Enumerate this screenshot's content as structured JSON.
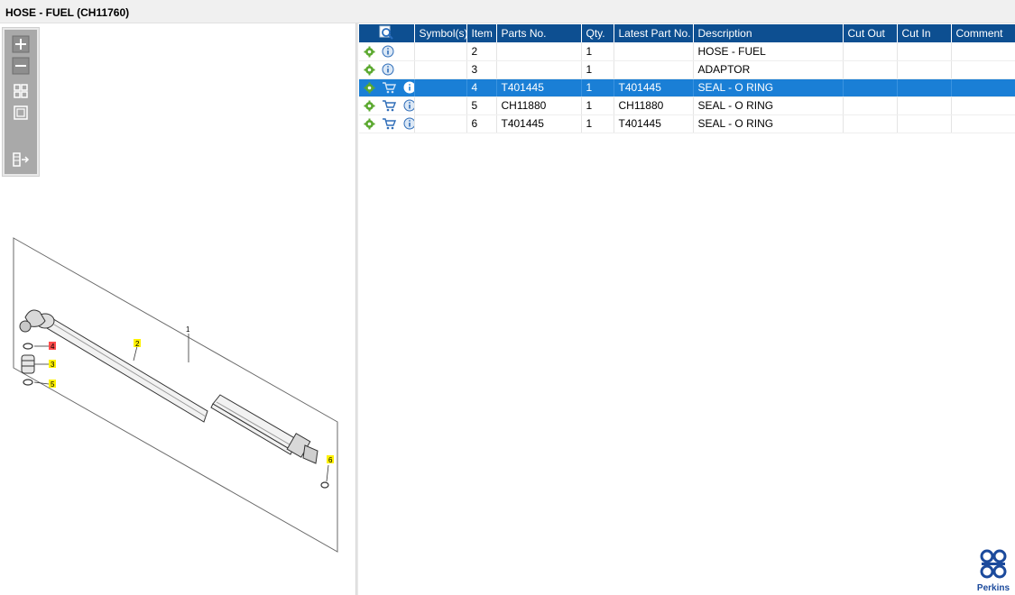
{
  "window": {
    "title": "HOSE - FUEL (CH11760)"
  },
  "toolbar": {
    "buttons": [
      "zoom-in",
      "zoom-out",
      "fit-all",
      "fit-window",
      "split-view"
    ]
  },
  "diagram": {
    "callouts": [
      {
        "label": "1",
        "highlight": "none"
      },
      {
        "label": "2",
        "highlight": "#fff200"
      },
      {
        "label": "3",
        "highlight": "#fff200"
      },
      {
        "label": "4",
        "highlight": "#ff4b4b"
      },
      {
        "label": "5",
        "highlight": "#fff200"
      },
      {
        "label": "6",
        "highlight": "#fff200"
      }
    ]
  },
  "table": {
    "columns": [
      "",
      "Symbol(s)",
      "Item",
      "Parts No.",
      "Qty.",
      "Latest Part No.",
      "Description",
      "Cut Out",
      "Cut In",
      "Comment"
    ],
    "rows": [
      {
        "icons": [
          "gear",
          "info"
        ],
        "symbols": "",
        "item": "2",
        "part_no": "",
        "qty": "1",
        "latest_part_no": "",
        "description": "HOSE - FUEL",
        "cut_out": "",
        "cut_in": "",
        "comment": "",
        "selected": false
      },
      {
        "icons": [
          "gear",
          "info"
        ],
        "symbols": "",
        "item": "3",
        "part_no": "",
        "qty": "1",
        "latest_part_no": "",
        "description": "ADAPTOR",
        "cut_out": "",
        "cut_in": "",
        "comment": "",
        "selected": false
      },
      {
        "icons": [
          "gear",
          "cart",
          "info"
        ],
        "symbols": "",
        "item": "4",
        "part_no": "T401445",
        "qty": "1",
        "latest_part_no": "T401445",
        "description": "SEAL - O RING",
        "cut_out": "",
        "cut_in": "",
        "comment": "",
        "selected": true
      },
      {
        "icons": [
          "gear",
          "cart",
          "info"
        ],
        "symbols": "",
        "item": "5",
        "part_no": "CH11880",
        "qty": "1",
        "latest_part_no": "CH11880",
        "description": "SEAL - O RING",
        "cut_out": "",
        "cut_in": "",
        "comment": "",
        "selected": false
      },
      {
        "icons": [
          "gear",
          "cart",
          "info"
        ],
        "symbols": "",
        "item": "6",
        "part_no": "T401445",
        "qty": "1",
        "latest_part_no": "T401445",
        "description": "SEAL - O RING",
        "cut_out": "",
        "cut_in": "",
        "comment": "",
        "selected": false
      }
    ]
  },
  "logo": {
    "brand": "Perkins",
    "color": "#1b4a9c"
  },
  "colors": {
    "header": "#0d4f91",
    "selected_row": "#1a7fd6",
    "gear": "#5aa82e",
    "info": "#2f6db8"
  }
}
